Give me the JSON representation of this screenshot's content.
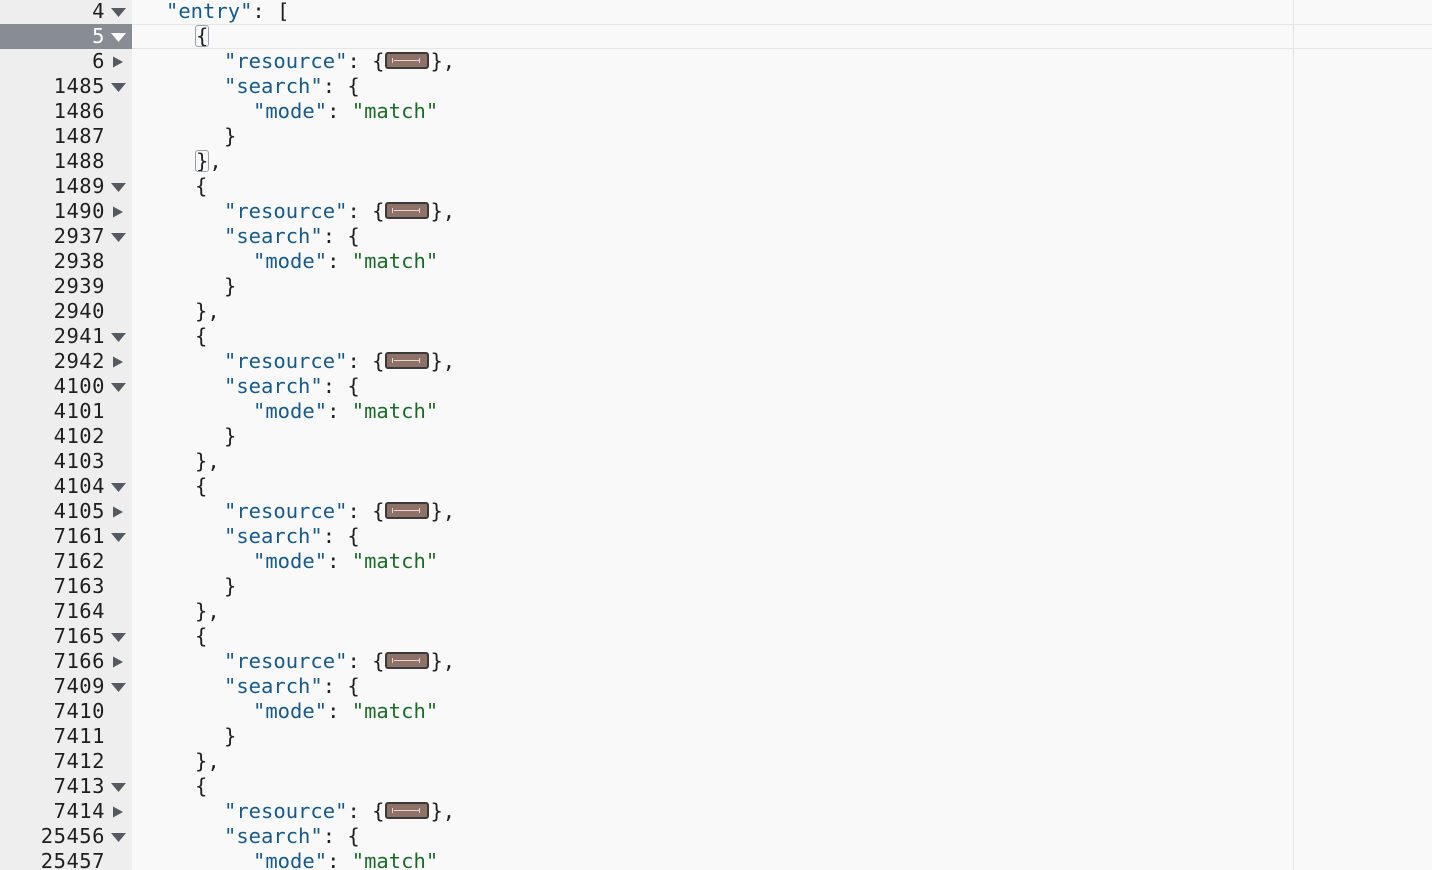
{
  "lines": [
    {
      "n": "4",
      "fold": "open",
      "indent": 0,
      "k": "entry",
      "after": ": [",
      "active": false
    },
    {
      "n": "5",
      "fold": "open",
      "indent": 1,
      "t": "{",
      "boxed": true,
      "active": true
    },
    {
      "n": "6",
      "fold": "closed",
      "indent": 2,
      "k": "resource",
      "collapsed": true,
      "after": "},"
    },
    {
      "n": "1485",
      "fold": "open",
      "indent": 2,
      "k": "search",
      "after": ": {"
    },
    {
      "n": "1486",
      "fold": "none",
      "indent": 3,
      "k": "mode",
      "v": "match"
    },
    {
      "n": "1487",
      "fold": "none",
      "indent": 2,
      "t": "}"
    },
    {
      "n": "1488",
      "fold": "none",
      "indent": 1,
      "t": "}",
      "boxed": true,
      "after": ","
    },
    {
      "n": "1489",
      "fold": "open",
      "indent": 1,
      "t": "{"
    },
    {
      "n": "1490",
      "fold": "closed",
      "indent": 2,
      "k": "resource",
      "collapsed": true,
      "after": "},"
    },
    {
      "n": "2937",
      "fold": "open",
      "indent": 2,
      "k": "search",
      "after": ": {"
    },
    {
      "n": "2938",
      "fold": "none",
      "indent": 3,
      "k": "mode",
      "v": "match"
    },
    {
      "n": "2939",
      "fold": "none",
      "indent": 2,
      "t": "}"
    },
    {
      "n": "2940",
      "fold": "none",
      "indent": 1,
      "t": "},"
    },
    {
      "n": "2941",
      "fold": "open",
      "indent": 1,
      "t": "{"
    },
    {
      "n": "2942",
      "fold": "closed",
      "indent": 2,
      "k": "resource",
      "collapsed": true,
      "after": "},"
    },
    {
      "n": "4100",
      "fold": "open",
      "indent": 2,
      "k": "search",
      "after": ": {"
    },
    {
      "n": "4101",
      "fold": "none",
      "indent": 3,
      "k": "mode",
      "v": "match"
    },
    {
      "n": "4102",
      "fold": "none",
      "indent": 2,
      "t": "}"
    },
    {
      "n": "4103",
      "fold": "none",
      "indent": 1,
      "t": "},"
    },
    {
      "n": "4104",
      "fold": "open",
      "indent": 1,
      "t": "{"
    },
    {
      "n": "4105",
      "fold": "closed",
      "indent": 2,
      "k": "resource",
      "collapsed": true,
      "after": "},"
    },
    {
      "n": "7161",
      "fold": "open",
      "indent": 2,
      "k": "search",
      "after": ": {"
    },
    {
      "n": "7162",
      "fold": "none",
      "indent": 3,
      "k": "mode",
      "v": "match"
    },
    {
      "n": "7163",
      "fold": "none",
      "indent": 2,
      "t": "}"
    },
    {
      "n": "7164",
      "fold": "none",
      "indent": 1,
      "t": "},"
    },
    {
      "n": "7165",
      "fold": "open",
      "indent": 1,
      "t": "{"
    },
    {
      "n": "7166",
      "fold": "closed",
      "indent": 2,
      "k": "resource",
      "collapsed": true,
      "after": "},"
    },
    {
      "n": "7409",
      "fold": "open",
      "indent": 2,
      "k": "search",
      "after": ": {"
    },
    {
      "n": "7410",
      "fold": "none",
      "indent": 3,
      "k": "mode",
      "v": "match"
    },
    {
      "n": "7411",
      "fold": "none",
      "indent": 2,
      "t": "}"
    },
    {
      "n": "7412",
      "fold": "none",
      "indent": 1,
      "t": "},"
    },
    {
      "n": "7413",
      "fold": "open",
      "indent": 1,
      "t": "{"
    },
    {
      "n": "7414",
      "fold": "closed",
      "indent": 2,
      "k": "resource",
      "collapsed": true,
      "after": "},"
    },
    {
      "n": "25456",
      "fold": "open",
      "indent": 2,
      "k": "search",
      "after": ": {"
    },
    {
      "n": "25457",
      "fold": "none",
      "indent": 3,
      "k": "mode",
      "v": "match"
    }
  ],
  "colors": {
    "key": "#175a8a",
    "string": "#1d6b2a",
    "gutter_bg": "#eeeeee",
    "active_line_number_bg": "#888d94",
    "collapsed_badge": "#8e7268"
  },
  "icons": {
    "fold_open": "triangle-down-icon",
    "fold_closed": "triangle-right-icon",
    "collapsed_object": "ellipsis-badge-icon"
  }
}
